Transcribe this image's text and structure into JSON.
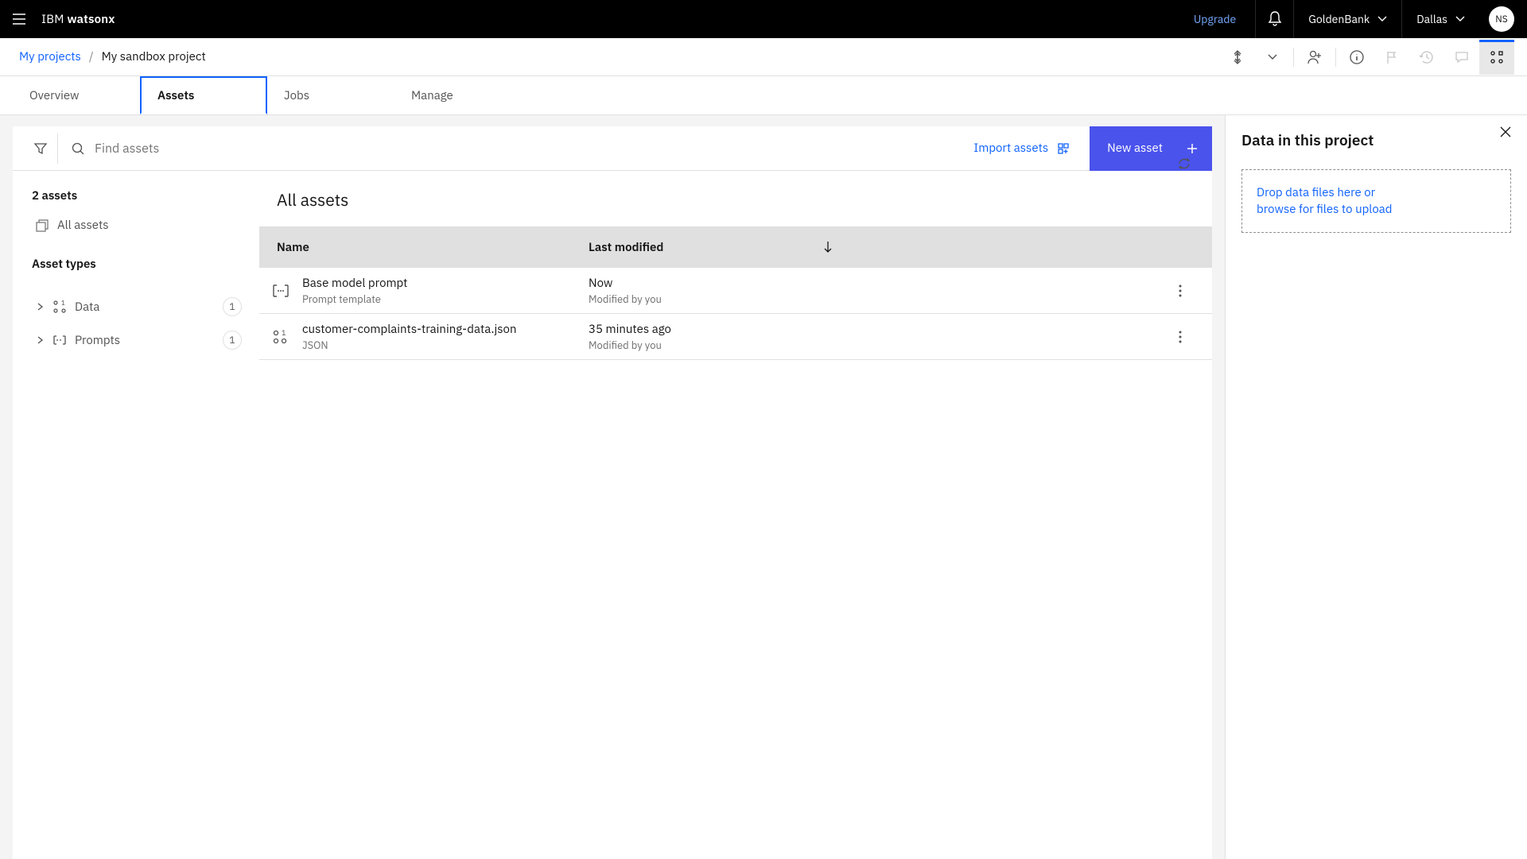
{
  "header": {
    "brand_prefix": "IBM ",
    "brand_bold": "watsonx",
    "upgrade": "Upgrade",
    "org": "GoldenBank",
    "region": "Dallas",
    "avatar_initials": "NS"
  },
  "breadcrumb": {
    "root": "My projects",
    "current": "My sandbox project"
  },
  "tabs": [
    "Overview",
    "Assets",
    "Jobs",
    "Manage"
  ],
  "active_tab": "Assets",
  "filterbar": {
    "placeholder": "Find assets",
    "import_label": "Import assets",
    "new_asset_label": "New asset"
  },
  "asset_nav": {
    "count_label": "2 assets",
    "all_label": "All assets",
    "types_heading": "Asset types",
    "types": [
      {
        "label": "Data",
        "count": 1
      },
      {
        "label": "Prompts",
        "count": 1
      }
    ]
  },
  "table": {
    "heading": "All assets",
    "col_name": "Name",
    "col_modified": "Last modified",
    "rows": [
      {
        "icon": "prompt",
        "name": "Base model prompt",
        "subtype": "Prompt template",
        "modified": "Now",
        "modified_by": "Modified by you"
      },
      {
        "icon": "data",
        "name": "customer-complaints-training-data.json",
        "subtype": "JSON",
        "modified": "35 minutes ago",
        "modified_by": "Modified by you"
      }
    ]
  },
  "side_panel": {
    "title": "Data in this project",
    "dropzone_line1": "Drop data files here or",
    "dropzone_line2": "browse for files to upload"
  }
}
